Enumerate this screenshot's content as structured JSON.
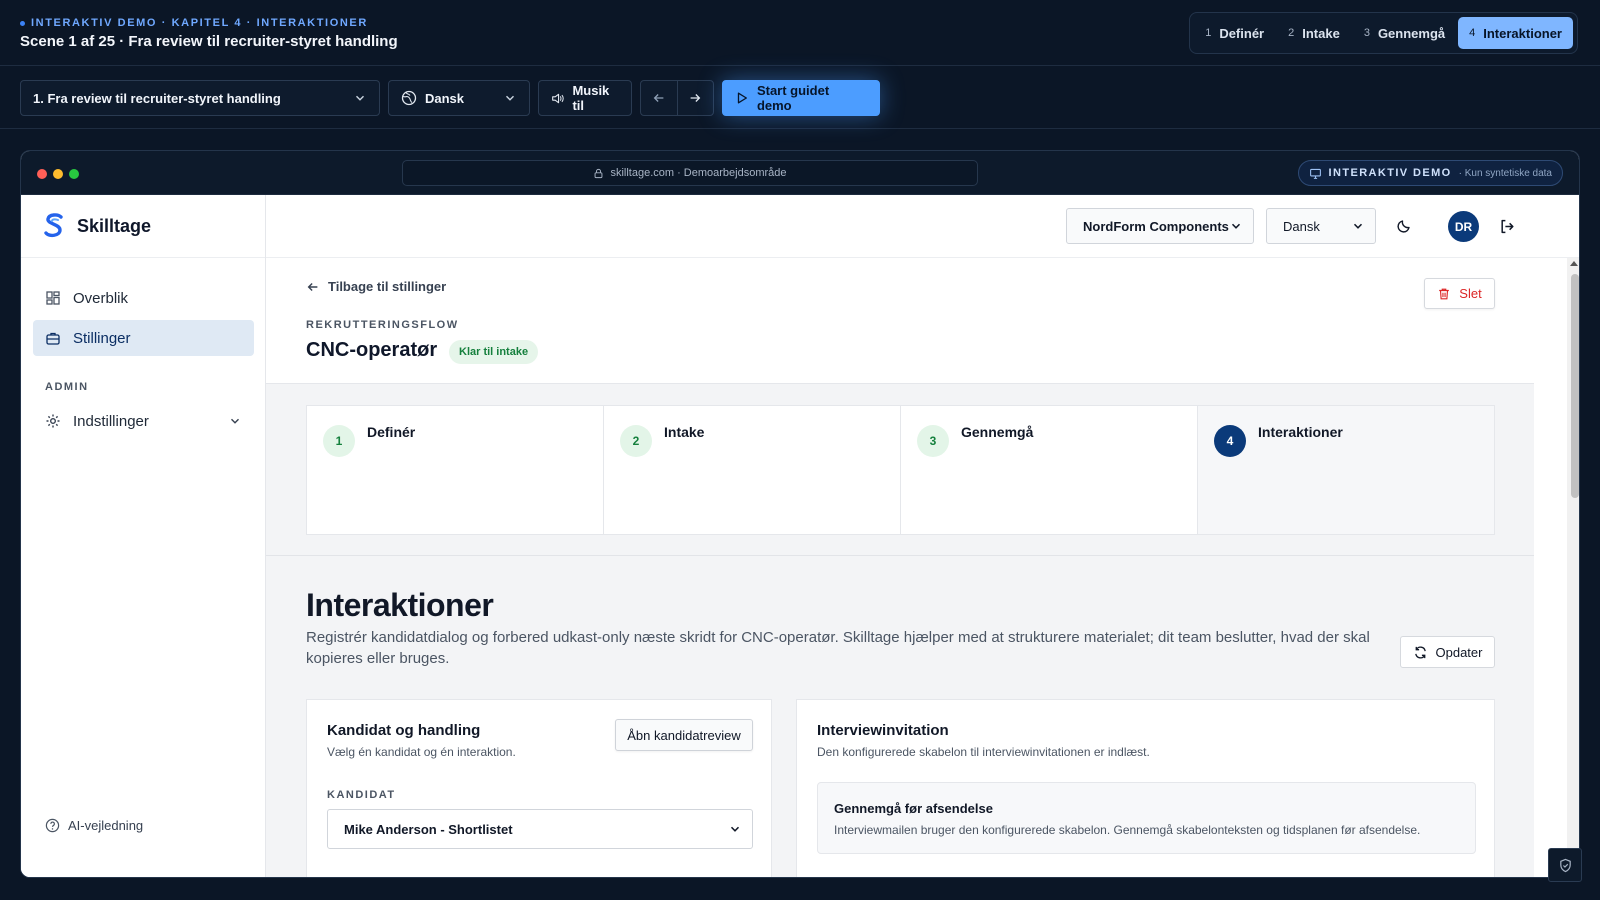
{
  "demo": {
    "eyebrow": "INTERAKTIV DEMO · KAPITEL 4 · INTERAKTIONER",
    "scene": "Scene 1 af 25 · Fra review til recruiter-styret handling",
    "chapters": [
      {
        "num": "1",
        "label": "Definér"
      },
      {
        "num": "2",
        "label": "Intake"
      },
      {
        "num": "3",
        "label": "Gennemgå"
      },
      {
        "num": "4",
        "label": "Interaktioner"
      }
    ],
    "active_chapter": "4",
    "controls": {
      "scene_select": "1. Fra review til recruiter-styret handling",
      "language": "Dansk",
      "music": "Musik til",
      "start": "Start guidet demo"
    }
  },
  "browser": {
    "url": "skilltage.com · Demoarbejdsområde",
    "badge_title": "INTERAKTIV DEMO",
    "badge_sub": "· Kun syntetiske data"
  },
  "app": {
    "brand": "Skilltage",
    "nav": {
      "overview": "Overblik",
      "jobs": "Stillinger",
      "section_admin": "ADMIN",
      "settings": "Indstillinger",
      "ai_help": "AI-vejledning"
    },
    "topbar": {
      "company": "NordForm Components",
      "language": "Dansk",
      "avatar_initials": "DR"
    },
    "job": {
      "back": "Tilbage til stillinger",
      "delete": "Slet",
      "eyebrow": "REKRUTTERINGSFLOW",
      "title": "CNC-operatør",
      "status": "Klar til intake"
    },
    "steps": [
      {
        "num": "1",
        "label": "Definér"
      },
      {
        "num": "2",
        "label": "Intake"
      },
      {
        "num": "3",
        "label": "Gennemgå"
      },
      {
        "num": "4",
        "label": "Interaktioner"
      }
    ],
    "section": {
      "title": "Interaktioner",
      "description": "Registrér kandidatdialog og forbered udkast-only næste skridt for CNC-operatør. Skilltage hjælper med at strukturere materialet; dit team beslutter, hvad der skal kopieres eller bruges.",
      "refresh": "Opdater"
    },
    "candidate_card": {
      "title": "Kandidat og handling",
      "subtitle": "Vælg én kandidat og én interaktion.",
      "open_review": "Åbn kandidatreview",
      "field_label": "KANDIDAT",
      "selected": "Mike Anderson - Shortlistet"
    },
    "invite_card": {
      "title": "Interviewinvitation",
      "subtitle": "Den konfigurerede skabelon til interviewinvitationen er indlæst.",
      "box_title": "Gennemgå før afsendelse",
      "box_text": "Interviewmailen bruger den konfigurerede skabelon. Gennemgå skabelonteksten og tidsplanen før afsendelse."
    }
  },
  "colors": {
    "accent": "#4c9dff",
    "brand_dark": "#0b3a7a",
    "success": "#15803d",
    "danger": "#dc2626"
  }
}
